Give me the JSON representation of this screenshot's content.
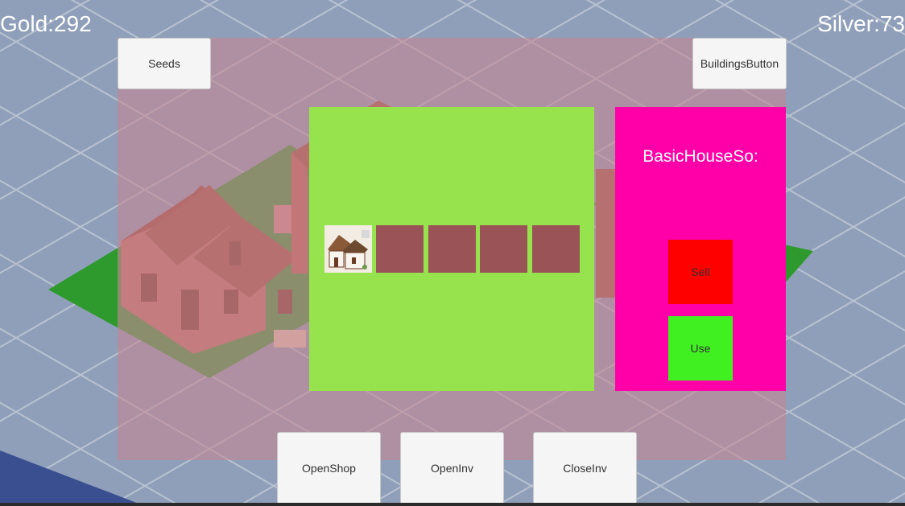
{
  "hud": {
    "gold": "Gold:292",
    "silver": "Silver:73"
  },
  "buttons": {
    "seeds": "Seeds",
    "buildings": "BuildingsButton",
    "open_shop": "OpenShop",
    "open_inv": "OpenInv",
    "close_inv": "CloseInv"
  },
  "inventory": {
    "slots": [
      {
        "item": "basic-house",
        "filled": true
      },
      {
        "item": "",
        "filled": false
      },
      {
        "item": "",
        "filled": false
      },
      {
        "item": "",
        "filled": false
      },
      {
        "item": "",
        "filled": false
      }
    ]
  },
  "detail": {
    "title": "BasicHouseSo:",
    "sell_label": "Sell",
    "use_label": "Use"
  },
  "colors": {
    "inventory_bg": "#96e34d",
    "detail_bg": "#ff00a8",
    "sell": "#ff0000",
    "use": "#40f020",
    "slot": "#9a5457"
  }
}
